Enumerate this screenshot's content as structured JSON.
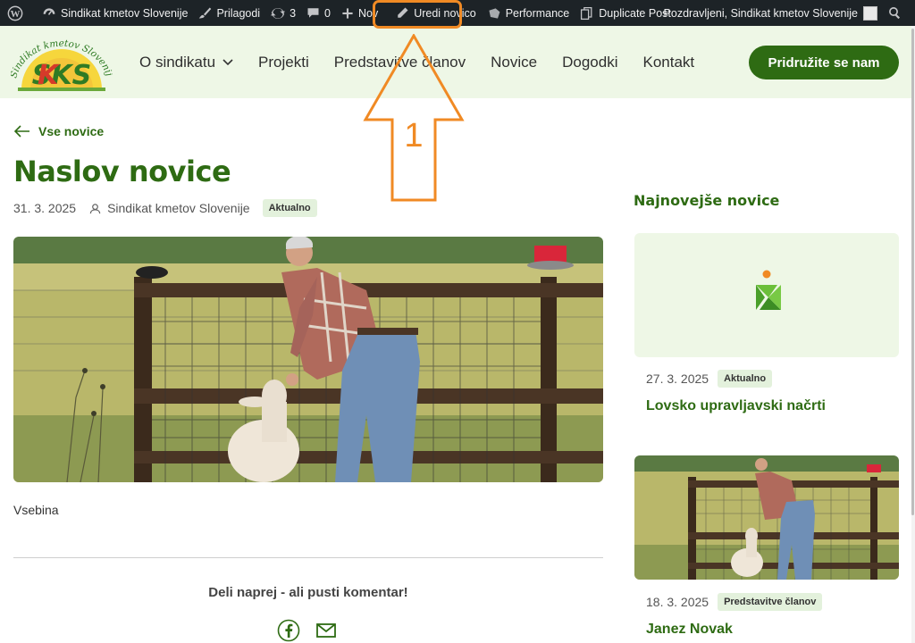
{
  "admin_bar": {
    "site_name": "Sindikat kmetov Slovenije",
    "customize": "Prilagodi",
    "updates_count": "3",
    "comments_count": "0",
    "new": "Nov",
    "edit_post": "Uredi novico",
    "performance": "Performance",
    "duplicate": "Duplicate Post",
    "greeting": "Pozdravljeni, Sindikat kmetov Slovenije"
  },
  "header": {
    "logo_text": "Sindikat kmetov Slovenije",
    "logo_initials": "SKS",
    "nav": [
      "O sindikatu",
      "Projekti",
      "Predstavitve članov",
      "Novice",
      "Dogodki",
      "Kontakt"
    ],
    "cta": "Pridružite se nam"
  },
  "post": {
    "back_label": "Vse novice",
    "title": "Naslov novice",
    "date": "31. 3. 2025",
    "author": "Sindikat kmetov Slovenije",
    "category": "Aktualno",
    "content": "Vsebina",
    "share_text": "Deli naprej - ali pusti komentar!"
  },
  "annotation": {
    "label": "1",
    "color": "#f08a24"
  },
  "sidebar": {
    "title": "Najnovejše novice",
    "cards": [
      {
        "date": "27. 3. 2025",
        "category": "Aktualno",
        "title": "Lovsko upravljavski načrti"
      },
      {
        "date": "18. 3. 2025",
        "category": "Predstavitve članov",
        "title": "Janez Novak"
      }
    ]
  },
  "colors": {
    "brand_green": "#2e6b13",
    "header_bg": "#eef7e6",
    "admin_bg": "#1d2327",
    "tag_bg": "#e3f1dc"
  }
}
